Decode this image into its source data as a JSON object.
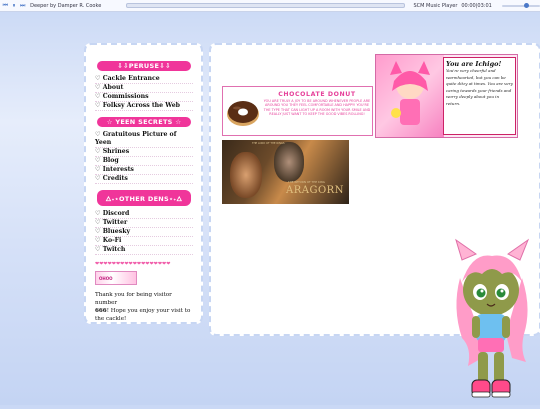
{
  "player": {
    "track_title": "Deeper by Damper R. Cooke",
    "player_name": "SCM Music Player",
    "time": "00:00|03:01"
  },
  "sidebar": {
    "sections": [
      {
        "header": "⇩⇩PERUSE⇩⇩",
        "items": [
          "♡ Cackle Entrance",
          "♡ About",
          "♡ Commissions",
          "♡ Folksy Across the Web"
        ]
      },
      {
        "header": "☆ YEEN SECRETS ☆",
        "items": [
          "♡ Gratuitous Picture of Yeen",
          "♡ Shrines",
          "♡ Blog",
          "♡ Interests",
          "♡ Credits"
        ]
      },
      {
        "header": "🜂˖⋆OTHER DENS⋆˖🜂",
        "items": [
          "♡ Discord",
          "♡ Twitter",
          "♡ Bluesky",
          "♡ Ko-Fi",
          "♡ Twitch"
        ]
      }
    ],
    "hearts": "❤❤❤❤❤❤❤❤❤❤❤❤❤❤❤❤❤❤",
    "stamp_text": "OHOO",
    "visitor_prefix": "Thank you for being visitor number",
    "visitor_number": "666",
    "visitor_suffix": "! Hope you enjoy your visit to the cackle!"
  },
  "main": {
    "donut_title": "CHOCOLATE DONUT",
    "donut_text": "YOU ARE TRULY A JOY TO BE AROUND WHENEVER PEOPLE ARE AROUND YOU THEY FEEL COMFORTABLE AND HAPPY! YOU'RE THE TYPE THAT CAN LIGHT UP A ROOM WITH YOUR SMILE AND REALLY JUST WANT TO KEEP THE GOOD VIBES ROLLING!",
    "ichigo_title": "You are Ichigo!",
    "ichigo_text": "You're very cheerful and warmhearted, but you can be quite ditzy at times. You are very caring towards your friends and worry deeply about you in return.",
    "aragorn_title": "ARAGORN",
    "aragorn_subtitle": "THE RETURN OF THE KING",
    "aragorn_top": "THE LORD OF THE RINGS"
  },
  "colors": {
    "accent": "#f0359a",
    "border": "#c7d6f3",
    "background": "#d6e1f8"
  }
}
